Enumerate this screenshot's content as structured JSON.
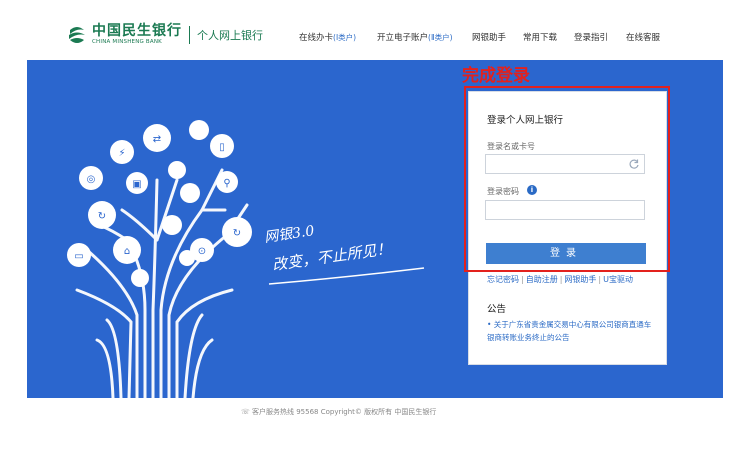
{
  "header": {
    "logo_cn": "中国民生银行",
    "logo_en": "CHINA MINSHENG BANK",
    "logo_sub": "个人网上银行",
    "nav": [
      {
        "label": "在线办卡",
        "tag": "(Ⅰ类户)"
      },
      {
        "label": "开立电子账户",
        "tag": "(Ⅱ类户)"
      },
      {
        "label": "网银助手",
        "tag": ""
      },
      {
        "label": "常用下载",
        "tag": ""
      },
      {
        "label": "登录指引",
        "tag": ""
      },
      {
        "label": "在线客服",
        "tag": ""
      }
    ]
  },
  "banner": {
    "slogan_line1": "网银3.0",
    "slogan_line2": "改变，不止所见！"
  },
  "annotation": {
    "label": "完成登录",
    "color": "#e3211d"
  },
  "login": {
    "title": "登录个人网上银行",
    "username_label": "登录名或卡号",
    "username_value": "",
    "password_label": "登录密码",
    "password_value": "",
    "submit_label": "登录",
    "quick_links": [
      "忘记密码",
      "自助注册",
      "网银助手",
      "U宝驱动"
    ]
  },
  "notice": {
    "title": "公告",
    "items": [
      "• 关于广东省贵金属交易中心有限公司银商直通车银商转账业务终止的公告"
    ]
  },
  "footer": {
    "text": "客户服务热线 95568 Copyright© 版权所有 中国民生银行"
  },
  "colors": {
    "brand_green": "#1b7a52",
    "banner_blue": "#2b66ce",
    "link_blue": "#2a6ac5",
    "button_blue": "#3e7fd0"
  }
}
